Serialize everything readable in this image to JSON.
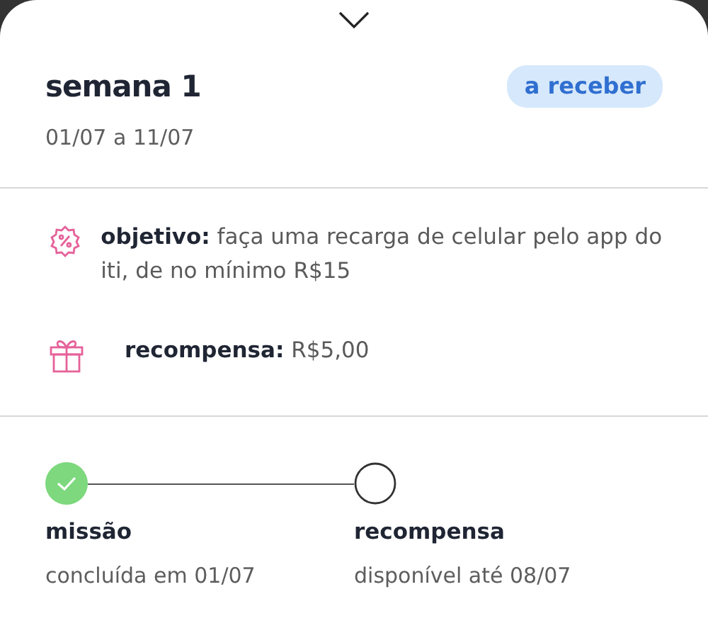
{
  "header": {
    "title": "semana 1",
    "dates": "01/07 a 11/07",
    "status": "a receber"
  },
  "details": [
    {
      "kind": "goal",
      "text": "**objetivo:** faça uma recarga de celular pelo app do iti, de no mínimo R$15"
    },
    {
      "kind": "reward",
      "text": "**recompensa:** R$5,00"
    }
  ],
  "steps": [
    {
      "title": "missão",
      "subtitle": "concluída em 01/07",
      "done": true
    },
    {
      "title": "recompensa",
      "subtitle": "disponível até 08/07",
      "done": false
    }
  ]
}
